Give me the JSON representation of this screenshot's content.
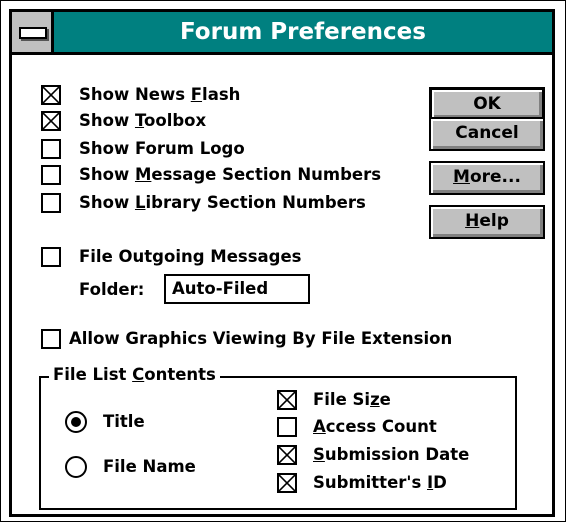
{
  "window": {
    "title": "Forum Preferences"
  },
  "options": [
    {
      "pre": "Show News ",
      "key": "F",
      "post": "lash",
      "checked": true
    },
    {
      "pre": "Show ",
      "key": "T",
      "post": "oolbox",
      "checked": true
    },
    {
      "pre": "Show Forum Logo",
      "key": "",
      "post": "",
      "checked": false
    },
    {
      "pre": "Show ",
      "key": "M",
      "post": "essage Section Numbers",
      "checked": false
    },
    {
      "pre": "Show ",
      "key": "L",
      "post": "ibrary Section Numbers",
      "checked": false
    }
  ],
  "file_outgoing": {
    "label": "File Outgoing Messages",
    "checked": false
  },
  "folder": {
    "label": "Folder:",
    "value": "Auto-Filed"
  },
  "graphics": {
    "label": "Allow Graphics Viewing By File Extension",
    "checked": false
  },
  "buttons": {
    "ok": "OK",
    "cancel": "Cancel",
    "more": {
      "key": "M",
      "rest": "ore..."
    },
    "help": {
      "key": "H",
      "rest": "elp"
    }
  },
  "file_list": {
    "title_pre": "File List ",
    "title_key": "C",
    "title_post": "ontents",
    "radios": [
      {
        "label": "Title",
        "selected": true
      },
      {
        "label": "File Name",
        "selected": false
      }
    ],
    "checks": [
      {
        "pre": "File Si",
        "key": "z",
        "post": "e",
        "checked": true
      },
      {
        "pre": "",
        "key": "A",
        "post": "ccess Count",
        "checked": false
      },
      {
        "pre": "",
        "key": "S",
        "post": "ubmission Date",
        "checked": true
      },
      {
        "pre": "Submitter's ",
        "key": "I",
        "post": "D",
        "checked": true
      }
    ]
  }
}
